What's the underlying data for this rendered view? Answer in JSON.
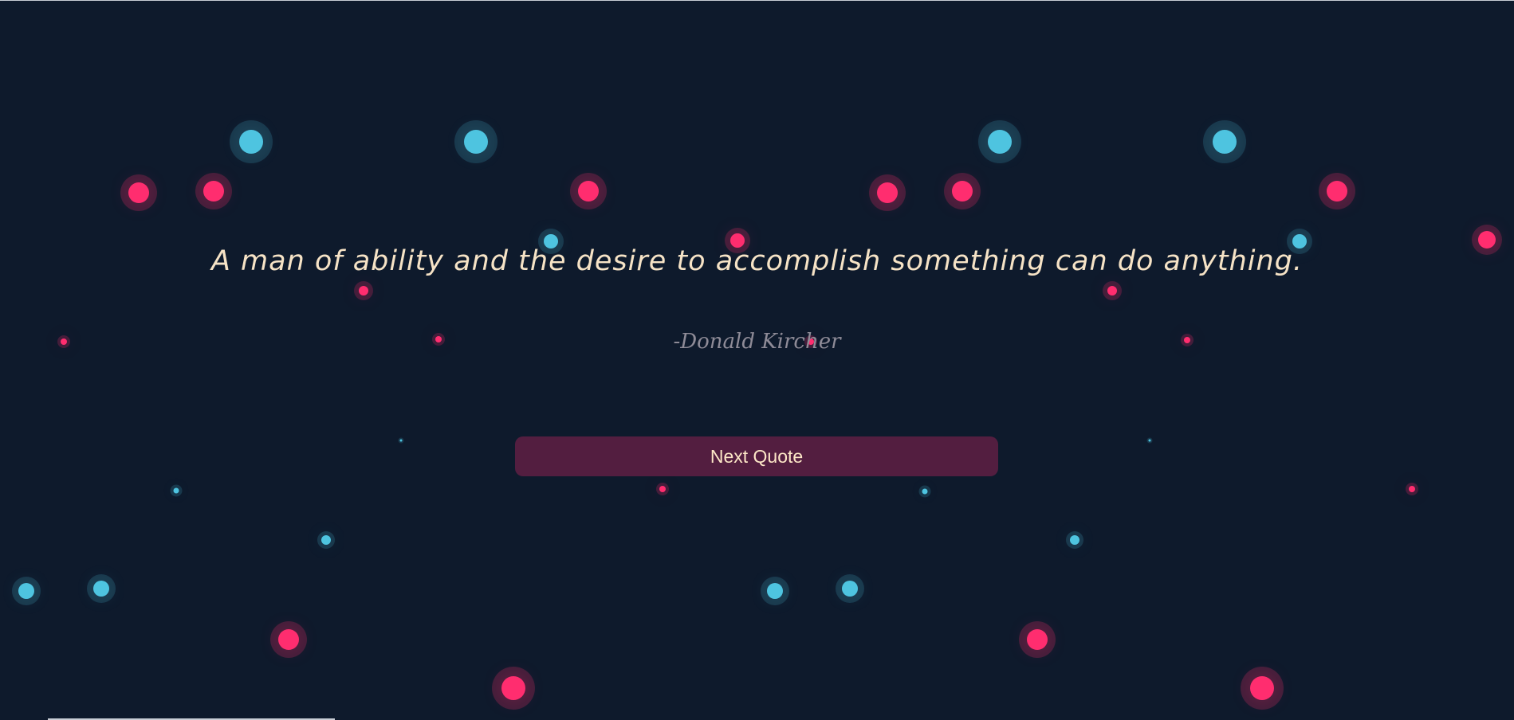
{
  "quote": {
    "text": "A man of ability and the desire to accomplish something can do anything.",
    "author": "-Donald Kircher"
  },
  "controls": {
    "next_label": "Next Quote"
  },
  "theme": {
    "background": "#0e1a2c",
    "quote_color": "#f6e3c6",
    "author_color": "#8e8b97",
    "button_color": "#531e40",
    "button_text_color": "#fde7c7",
    "dot_pink": "#ff2d6f",
    "dot_blue": "#4ec4e0"
  }
}
